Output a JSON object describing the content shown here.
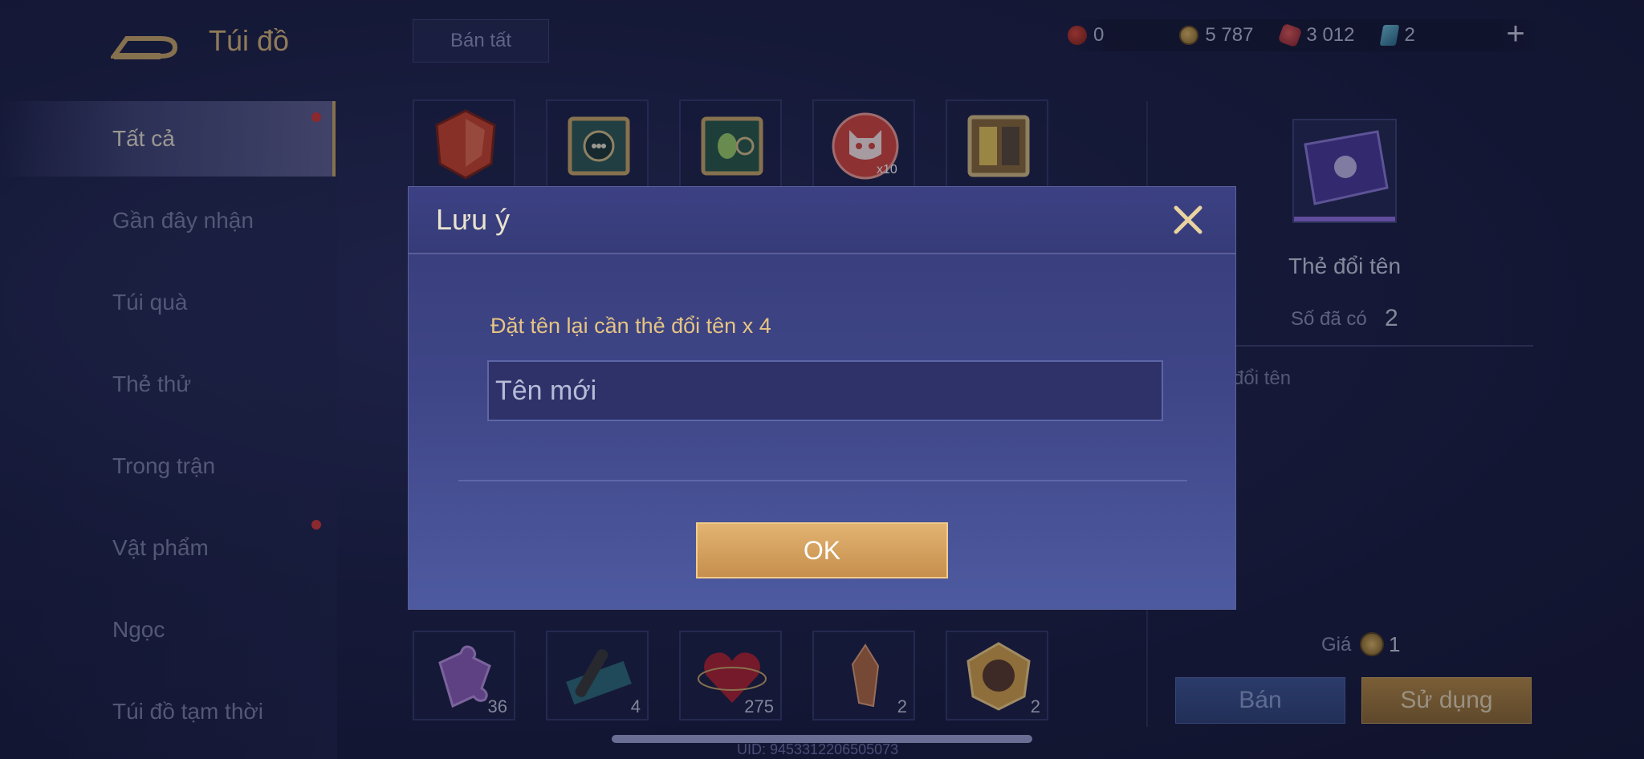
{
  "header": {
    "title": "Túi đồ",
    "sell_all_label": "Bán tất",
    "currencies": [
      {
        "name": "red-gem",
        "value": "0",
        "color": "#d9483a"
      },
      {
        "name": "gold-coin",
        "value": "5 787",
        "color": "#e0b865"
      },
      {
        "name": "ruby",
        "value": "3 012",
        "color": "#e05a5a"
      },
      {
        "name": "card",
        "value": "2",
        "color": "#6fc1d9"
      }
    ],
    "plus_icon": "+"
  },
  "sidebar": {
    "items": [
      {
        "label": "Tất cả",
        "active": true,
        "dot": true
      },
      {
        "label": "Gần đây nhận",
        "active": false,
        "dot": false
      },
      {
        "label": "Túi quà",
        "active": false,
        "dot": false
      },
      {
        "label": "Thẻ thử",
        "active": false,
        "dot": false
      },
      {
        "label": "Trong trận",
        "active": false,
        "dot": false
      },
      {
        "label": "Vật phẩm",
        "active": false,
        "dot": true
      },
      {
        "label": "Ngọc",
        "active": false,
        "dot": false
      },
      {
        "label": "Túi đồ tạm thời",
        "active": false,
        "dot": false
      }
    ]
  },
  "grid": {
    "top_row": [
      {
        "icon": "red-crystal-icon",
        "qty": ""
      },
      {
        "icon": "mystery-chest-icon",
        "qty": ""
      },
      {
        "icon": "mystery-chest-icon",
        "qty": ""
      },
      {
        "icon": "cat-coin-icon",
        "qty": ""
      },
      {
        "icon": "golden-chest-icon",
        "qty": ""
      }
    ],
    "bottom_row": [
      {
        "icon": "puzzle-piece-icon",
        "qty": "36"
      },
      {
        "icon": "scroll-icon",
        "qty": "4"
      },
      {
        "icon": "heart-gem-icon",
        "qty": "275"
      },
      {
        "icon": "crystal-shard-icon",
        "qty": "2"
      },
      {
        "icon": "hero-gem-icon",
        "qty": "2"
      }
    ]
  },
  "detail": {
    "item_name": "Thẻ đổi tên",
    "owned_label": "Số đã có",
    "owned_count": "2",
    "description": "đổi tên",
    "price_label": "Giá",
    "price_value": "1",
    "sell_label": "Bán",
    "use_label": "Sử dụng"
  },
  "modal": {
    "title": "Lưu ý",
    "message": "Đặt tên lại cần thẻ đổi tên x 4",
    "input_placeholder": "Tên mới",
    "ok_label": "OK"
  },
  "footer": {
    "uid": "UID: 9453312206505073"
  }
}
